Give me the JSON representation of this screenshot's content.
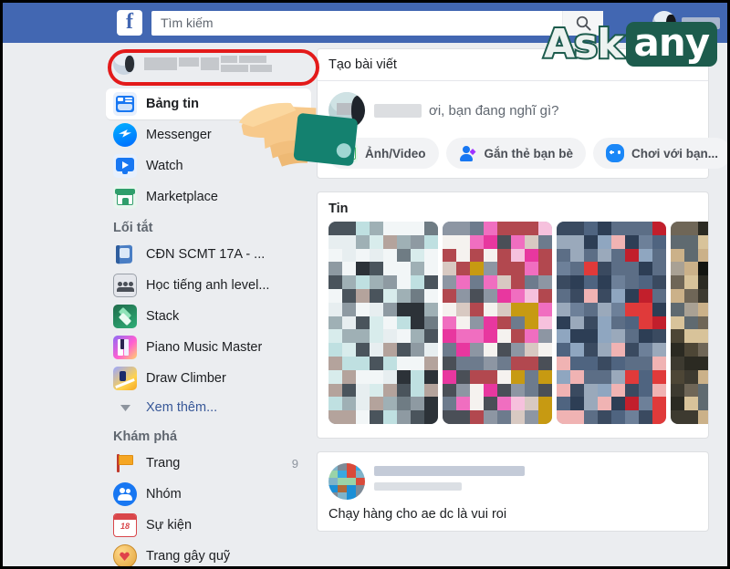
{
  "header": {
    "logo": "f",
    "search": {
      "placeholder": "Tìm kiếm",
      "value": "",
      "icon": "search-icon"
    },
    "profile_name_redacted": ""
  },
  "sidebar": {
    "profile": {
      "name_redacted": "",
      "highlighted": true,
      "highlight_color": "#e31a1a"
    },
    "main_items": [
      {
        "label": "Bảng tin",
        "icon": "news-feed-icon",
        "active": true
      },
      {
        "label": "Messenger",
        "icon": "messenger-icon",
        "active": false
      },
      {
        "label": "Watch",
        "icon": "watch-icon",
        "active": false
      },
      {
        "label": "Marketplace",
        "icon": "marketplace-icon",
        "active": false
      }
    ],
    "shortcuts_title": "Lối tắt",
    "shortcuts": [
      {
        "label": "CĐN SCMT 17A - ...",
        "icon": "group-book-icon"
      },
      {
        "label": "Học tiếng anh level...",
        "icon": "group-people-icon"
      },
      {
        "label": "Stack",
        "icon": "stack-game-icon"
      },
      {
        "label": "Piano Music Master",
        "icon": "piano-game-icon"
      },
      {
        "label": "Draw Climber",
        "icon": "draw-climber-game-icon"
      }
    ],
    "see_more": {
      "label": "Xem thêm...",
      "icon": "chevron-down-icon"
    },
    "explore_title": "Khám phá",
    "explore": [
      {
        "label": "Trang",
        "icon": "pages-flag-icon",
        "badge": "9"
      },
      {
        "label": "Nhóm",
        "icon": "groups-icon",
        "badge": ""
      },
      {
        "label": "Sự kiện",
        "icon": "events-calendar-icon",
        "badge": "",
        "calendar_day": "18"
      },
      {
        "label": "Trang gây quỹ",
        "icon": "fundraiser-heart-icon",
        "badge": ""
      }
    ]
  },
  "composer": {
    "title": "Tạo bài viết",
    "placeholder_suffix": "ơi, bạn đang nghĩ gì?",
    "actions": [
      {
        "label": "Ảnh/Video",
        "icon": "photo-video-icon"
      },
      {
        "label": "Gắn thẻ bạn bè",
        "icon": "tag-friends-icon"
      },
      {
        "label": "Chơi với bạn...",
        "icon": "play-with-friends-icon"
      }
    ]
  },
  "stories": {
    "title": "Tin",
    "count": 4
  },
  "post": {
    "text": "Chạy hàng cho ae dc là vui roi"
  },
  "watermark": {
    "part1": "Ask",
    "part2": "any",
    "color": "#1d5c4d"
  },
  "cursor": {
    "icon": "pointing-hand-icon"
  },
  "colors": {
    "header_blue": "#4267b2",
    "page_bg": "#ebedf0",
    "link_blue": "#385898"
  }
}
